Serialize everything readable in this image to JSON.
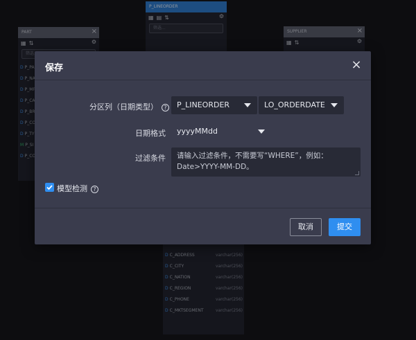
{
  "background_tables": {
    "part": {
      "title": "PART",
      "filter_placeholder": "筛选...",
      "rows": [
        {
          "key": "D",
          "name": "P_PA"
        },
        {
          "key": "D",
          "name": "P_NA"
        },
        {
          "key": "D",
          "name": "P_MF"
        },
        {
          "key": "D",
          "name": "P_CA"
        },
        {
          "key": "D",
          "name": "P_BR"
        },
        {
          "key": "D",
          "name": "P_CO"
        },
        {
          "key": "D",
          "name": "P_TY"
        },
        {
          "key": "M",
          "name": "P_SI"
        },
        {
          "key": "D",
          "name": "P_CO"
        }
      ]
    },
    "lineorder": {
      "title": "P_LINEORDER",
      "filter_placeholder": "筛选..."
    },
    "supplier": {
      "title": "SUPPLIER"
    },
    "customer": {
      "rows": [
        {
          "key": "D",
          "name": "C_ADDRESS",
          "type": "varchar(256)"
        },
        {
          "key": "D",
          "name": "C_CITY",
          "type": "varchar(256)"
        },
        {
          "key": "D",
          "name": "C_NATION",
          "type": "varchar(256)"
        },
        {
          "key": "D",
          "name": "C_REGION",
          "type": "varchar(256)"
        },
        {
          "key": "D",
          "name": "C_PHONE",
          "type": "varchar(256)"
        },
        {
          "key": "D",
          "name": "C_MKTSEGMENT",
          "type": "varchar(256)"
        }
      ]
    }
  },
  "modal": {
    "title": "保存",
    "close_icon": "close-icon",
    "partition_label": "分区列（日期类型）",
    "partition_table": "P_LINEORDER",
    "partition_column": "LO_ORDERDATE",
    "date_format_label": "日期格式",
    "date_format_value": "yyyyMMdd",
    "filter_label": "过滤条件",
    "filter_placeholder": "请输入过滤条件，不需要写“WHERE”，例如：Date>YYYY-MM-DD。",
    "model_check_label": "模型检测",
    "model_check_checked": true,
    "cancel_label": "取消",
    "submit_label": "提交"
  },
  "colors": {
    "accent": "#2f8ef0",
    "modal_bg": "#3a3c4d",
    "input_bg": "#282a36"
  }
}
